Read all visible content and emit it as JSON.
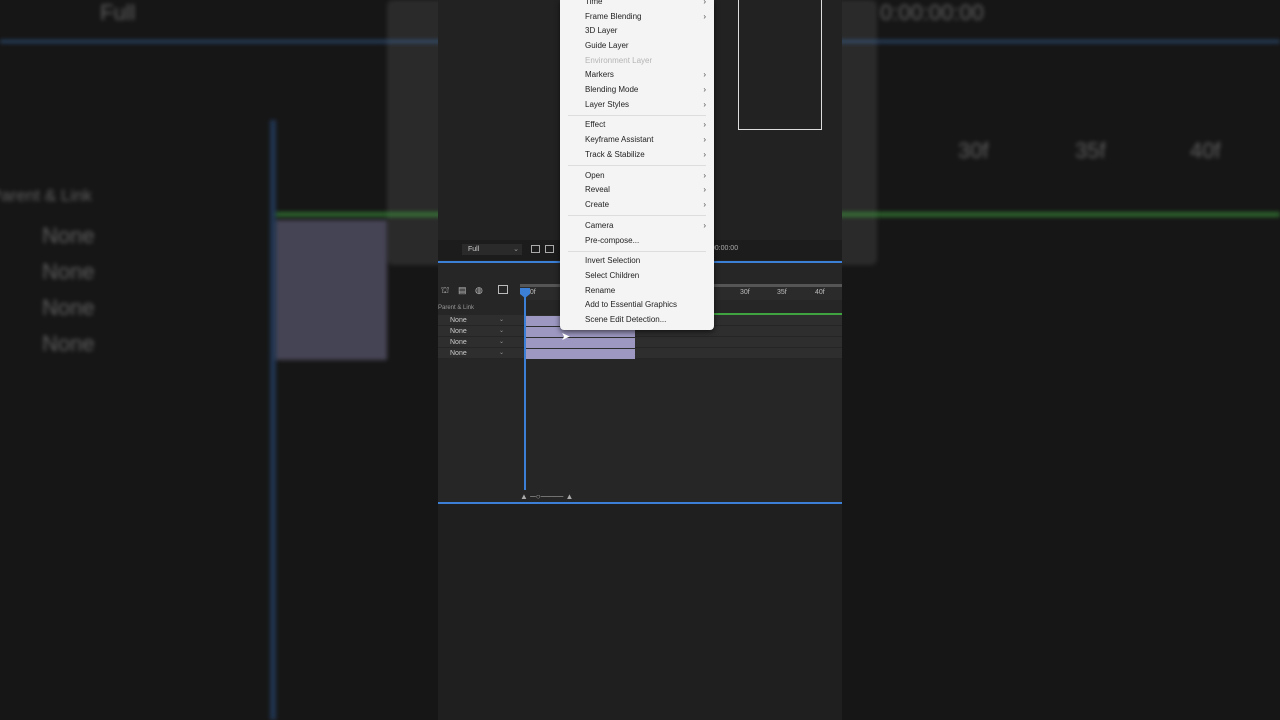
{
  "viewer": {
    "resolution": "Full",
    "timecode": "0:00:00:00"
  },
  "timeline": {
    "column_header": "Parent & Link",
    "ruler_start": "00f",
    "ruler_labels": [
      "30f",
      "35f",
      "40f"
    ],
    "layers": [
      {
        "parent": "None"
      },
      {
        "parent": "None"
      },
      {
        "parent": "None"
      },
      {
        "parent": "None"
      }
    ]
  },
  "context_menu": {
    "items": [
      {
        "label": "Time",
        "submenu": true
      },
      {
        "label": "Frame Blending",
        "submenu": true
      },
      {
        "label": "3D Layer"
      },
      {
        "label": "Guide Layer"
      },
      {
        "label": "Environment Layer",
        "disabled": true
      },
      {
        "label": "Markers",
        "submenu": true
      },
      {
        "label": "Blending Mode",
        "submenu": true
      },
      {
        "label": "Layer Styles",
        "submenu": true
      },
      {
        "label": "Effect",
        "submenu": true
      },
      {
        "label": "Keyframe Assistant",
        "submenu": true
      },
      {
        "label": "Track & Stabilize",
        "submenu": true
      },
      {
        "label": "Open",
        "submenu": true
      },
      {
        "label": "Reveal",
        "submenu": true
      },
      {
        "label": "Create",
        "submenu": true
      },
      {
        "label": "Camera",
        "submenu": true
      },
      {
        "label": "Pre-compose..."
      },
      {
        "label": "Invert Selection"
      },
      {
        "label": "Select Children"
      },
      {
        "label": "Rename"
      },
      {
        "label": "Add to Essential Graphics"
      },
      {
        "label": "Scene Edit Detection..."
      }
    ]
  },
  "colors": {
    "accent": "#3b7fd6",
    "bar": "#9d98c2",
    "work_area": "#3fa43f"
  }
}
